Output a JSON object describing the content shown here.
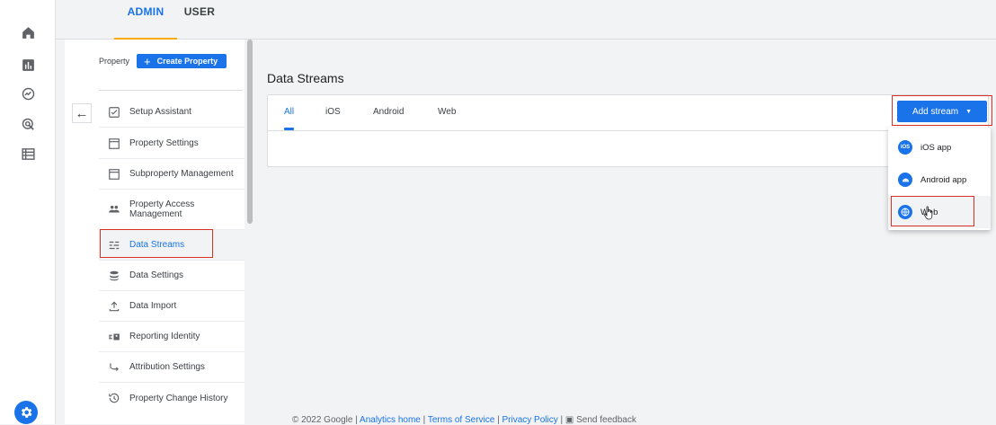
{
  "rail": {
    "icons": [
      "home-icon",
      "reports-icon",
      "explore-icon",
      "advertising-icon",
      "configure-icon",
      "gear-icon"
    ]
  },
  "top_tabs": {
    "admin": "ADMIN",
    "user": "USER"
  },
  "nav": {
    "property_label": "Property",
    "create_property": "Create Property",
    "items": [
      {
        "label": "Setup Assistant",
        "icon": "checkbox-icon"
      },
      {
        "label": "Property Settings",
        "icon": "window-icon"
      },
      {
        "label": "Subproperty Management",
        "icon": "window-icon"
      },
      {
        "label": "Property Access Management",
        "icon": "people-icon"
      },
      {
        "label": "Data Streams",
        "icon": "streams-icon"
      },
      {
        "label": "Data Settings",
        "icon": "database-icon"
      },
      {
        "label": "Data Import",
        "icon": "upload-icon"
      },
      {
        "label": "Reporting Identity",
        "icon": "identity-icon"
      },
      {
        "label": "Attribution Settings",
        "icon": "attribution-icon"
      },
      {
        "label": "Property Change History",
        "icon": "history-icon"
      }
    ]
  },
  "main": {
    "title": "Data Streams",
    "tabs": [
      "All",
      "iOS",
      "Android",
      "Web"
    ],
    "active_tab": "All",
    "add_stream": "Add stream",
    "menu": [
      "iOS app",
      "Android app",
      "Web"
    ]
  },
  "footer": {
    "copyright": "© 2022 Google |",
    "analytics_home": "Analytics home",
    "sep": "|",
    "terms": "Terms of Service",
    "privacy": "Privacy Policy",
    "send_feedback": "Send feedback"
  },
  "colors": {
    "accent": "#1a73e8",
    "highlight": "#d93025",
    "tab_underline": "#f9ab00"
  }
}
